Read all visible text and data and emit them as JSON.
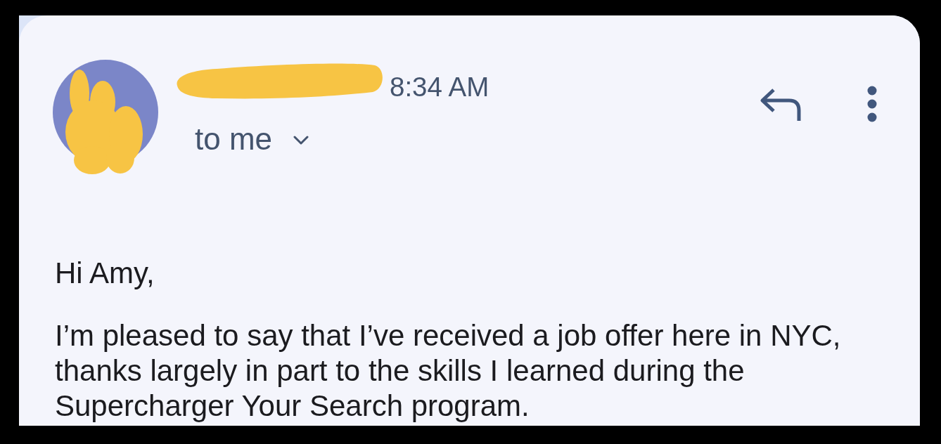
{
  "header": {
    "time": "8:34 AM",
    "recipients": {
      "label": "to me",
      "expanded": false
    }
  },
  "body": {
    "greeting": "Hi Amy,",
    "paragraphs": [
      "I’m pleased to say that I’ve received a job offer here in NYC, thanks largely in part to the skills I learned during the Supercharger Your Search program."
    ]
  }
}
